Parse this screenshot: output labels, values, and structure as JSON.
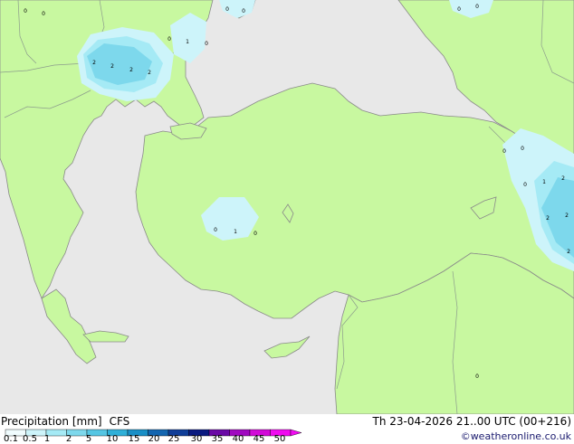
{
  "legend": {
    "title": "Precipitation [mm]",
    "model": "CFS",
    "datetime": "Th 23-04-2026 21..00 UTC (00+216)",
    "credit": "©weatheronline.co.uk",
    "scale_labels": [
      "0.1",
      "0.5",
      "1",
      "2",
      "5",
      "10",
      "15",
      "20",
      "25",
      "30",
      "35",
      "40",
      "45",
      "50"
    ],
    "scale_colors": [
      "#f0fcfe",
      "#cdf4fa",
      "#a5eaf5",
      "#7dd8ec",
      "#55c6e3",
      "#2fb0d8",
      "#1a8fc6",
      "#1466b0",
      "#103e98",
      "#0a1a80",
      "#6a0aa5",
      "#a00ac0",
      "#d20ad8",
      "#f00af0"
    ]
  },
  "map": {
    "colors": {
      "sea": "#e8e8e8",
      "land": "#c8f8a0",
      "coast": "#8a8a8a",
      "border": "#8c9c8c"
    },
    "value_labels": [
      {
        "text": "0"
      },
      {
        "text": "0"
      },
      {
        "text": "0"
      },
      {
        "text": "0"
      },
      {
        "text": "0"
      },
      {
        "text": "0"
      },
      {
        "text": "0"
      },
      {
        "text": "1"
      },
      {
        "text": "0"
      },
      {
        "text": "2"
      },
      {
        "text": "2"
      },
      {
        "text": "2"
      },
      {
        "text": "2"
      },
      {
        "text": "0"
      },
      {
        "text": "0"
      },
      {
        "text": "0"
      },
      {
        "text": "1"
      },
      {
        "text": "2"
      },
      {
        "text": "2"
      },
      {
        "text": "2"
      },
      {
        "text": "2"
      },
      {
        "text": "0"
      },
      {
        "text": "1"
      },
      {
        "text": "0"
      },
      {
        "text": "0"
      }
    ]
  }
}
